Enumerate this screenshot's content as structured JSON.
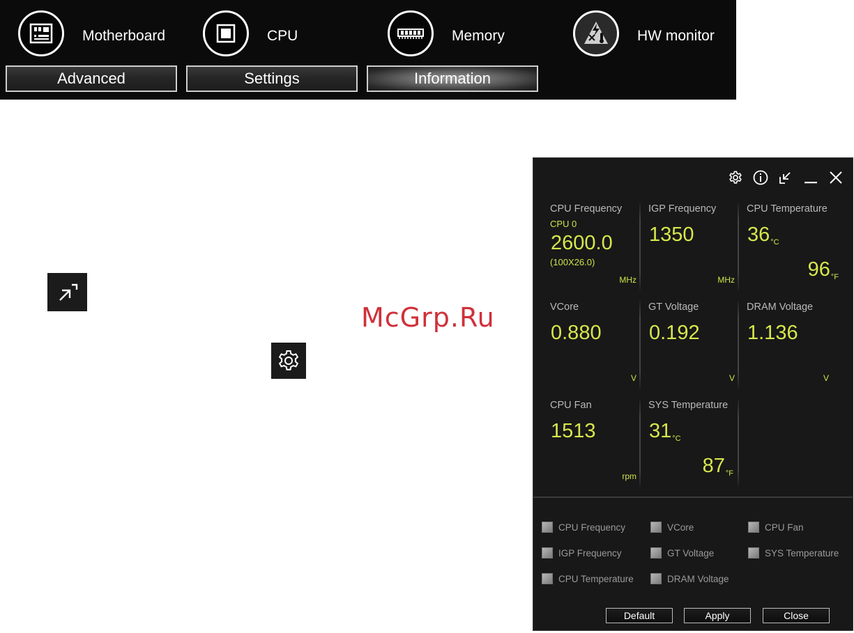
{
  "topnav": {
    "items": [
      {
        "label": "Motherboard",
        "icon": "motherboard-icon"
      },
      {
        "label": "CPU",
        "icon": "cpu-chip-icon"
      },
      {
        "label": "Memory",
        "icon": "memory-module-icon"
      },
      {
        "label": "HW monitor",
        "icon": "hw-monitor-icon"
      }
    ],
    "tabs": [
      "Advanced",
      "Settings",
      "Information"
    ],
    "active_tab": "Information"
  },
  "left_icons": {
    "restore": "restore-window-icon",
    "settings": "gear-icon"
  },
  "watermark": "McGrp.Ru",
  "panel": {
    "title_icons": [
      "gear-icon",
      "info-icon",
      "restore-down-icon",
      "minimize-icon",
      "close-icon"
    ],
    "readings": {
      "cpu_freq": {
        "label": "CPU Frequency",
        "sub": "CPU 0",
        "value": "2600.0",
        "detail": "(100X26.0)",
        "unit": "MHz"
      },
      "igp_freq": {
        "label": "IGP Frequency",
        "value": "1350",
        "unit": "MHz"
      },
      "cpu_temp": {
        "label": "CPU Temperature",
        "value_c": "36",
        "unit_c": "°C",
        "value_f": "96",
        "unit_f": "°F"
      },
      "vcore": {
        "label": "VCore",
        "value": "0.880",
        "unit": "V"
      },
      "gt_voltage": {
        "label": "GT Voltage",
        "value": "0.192",
        "unit": "V"
      },
      "dram_voltage": {
        "label": "DRAM Voltage",
        "value": "1.136",
        "unit": "V"
      },
      "cpu_fan": {
        "label": "CPU Fan",
        "value": "1513",
        "unit": "rpm"
      },
      "sys_temp": {
        "label": "SYS Temperature",
        "value_c": "31",
        "unit_c": "°C",
        "value_f": "87",
        "unit_f": "°F"
      }
    },
    "checkboxes": [
      "CPU Frequency",
      "VCore",
      "CPU Fan",
      "IGP Frequency",
      "GT Voltage",
      "SYS Temperature",
      "CPU Temperature",
      "DRAM Voltage"
    ],
    "buttons": {
      "default": "Default",
      "apply": "Apply",
      "close": "Close"
    }
  },
  "colors": {
    "value_text": "#d6e64c",
    "panel_bg": "#181818",
    "topbar_bg": "#0b0b0b"
  }
}
